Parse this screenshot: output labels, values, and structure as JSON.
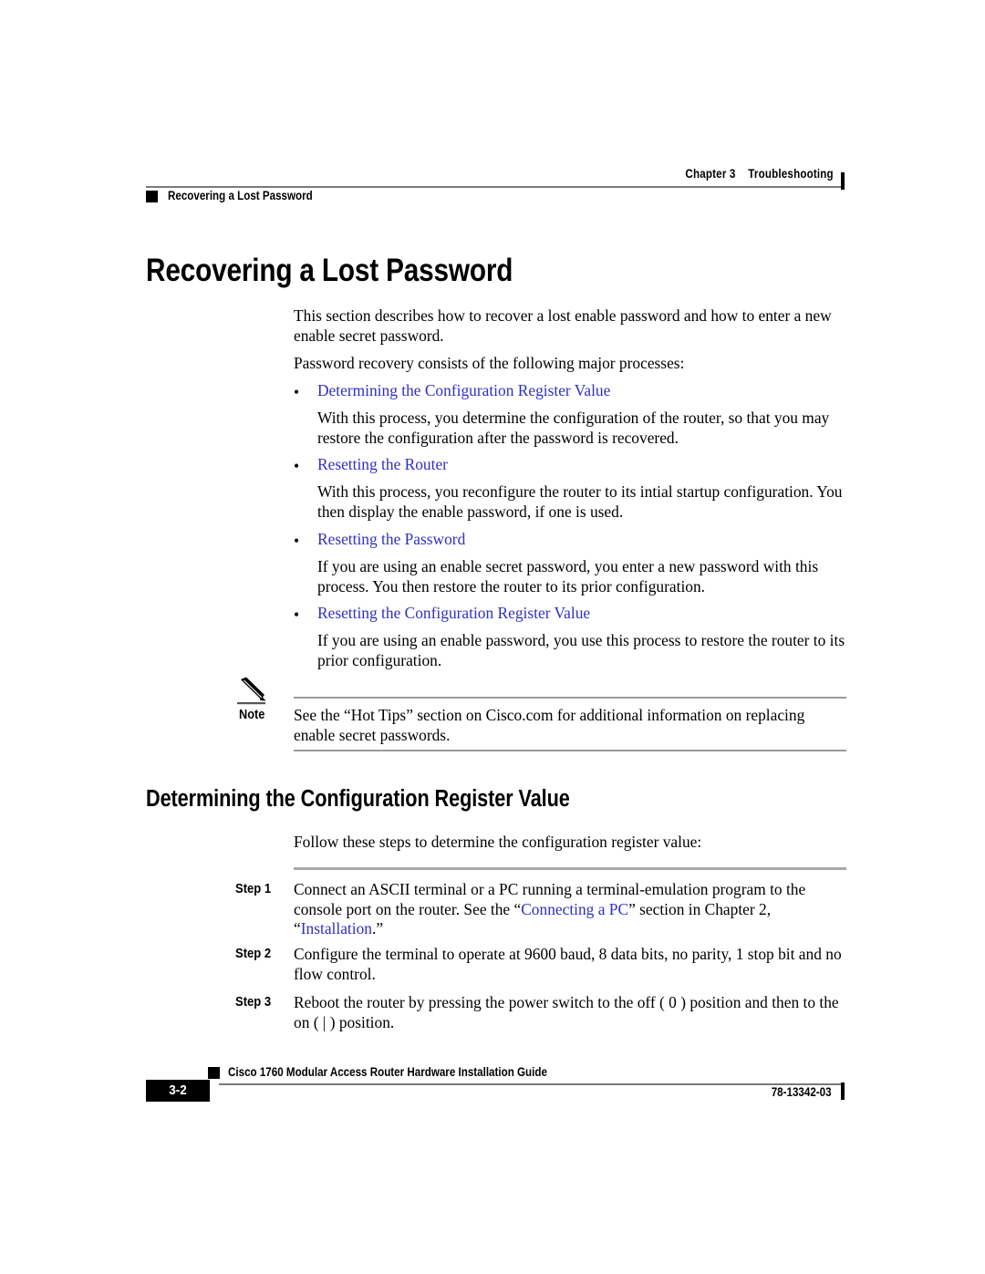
{
  "header": {
    "chapter_label": "Chapter 3",
    "chapter_title": "Troubleshooting",
    "section_title": "Recovering a Lost Password"
  },
  "main": {
    "title": "Recovering a Lost Password",
    "intro_paragraph": "This section describes how to recover a lost enable password and how to enter a new enable secret password.",
    "processes_lead": "Password recovery consists of the following major processes:",
    "bullet_char": "•",
    "processes": [
      {
        "link": "Determining the Configuration Register Value",
        "description": "With this process, you determine the configuration of the router, so that you may restore the configuration after the password is recovered."
      },
      {
        "link": "Resetting the Router",
        "description": "With this process, you reconfigure the router to its intial startup configuration. You then display the enable password, if one is used."
      },
      {
        "link": "Resetting the Password",
        "description": "If you are using an enable secret password, you enter a new password with this process. You then restore the router to its prior configuration."
      },
      {
        "link": "Resetting the Configuration Register Value",
        "description": "If you are using an enable password, you use this process to restore the router to its prior configuration."
      }
    ],
    "note": {
      "label": "Note",
      "icon": "pencil-icon",
      "text": "See the “Hot Tips” section on Cisco.com for additional information on replacing enable secret passwords."
    },
    "subheading": "Determining the Configuration Register Value",
    "steps_lead": "Follow these steps to determine the configuration register value:",
    "steps": [
      {
        "label": "Step 1",
        "text_part1": "Connect an ASCII terminal or a PC running a terminal-emulation program to the console port on the router. See the “",
        "link1": "Connecting a PC",
        "text_part2": "” section in Chapter 2, “",
        "link2": "Installation",
        "text_part3": ".”"
      },
      {
        "label": "Step 2",
        "text_part1": "Configure the terminal to operate at 9600 baud, 8 data bits, no parity,  1 stop bit and no flow control.",
        "link1": "",
        "text_part2": "",
        "link2": "",
        "text_part3": ""
      },
      {
        "label": "Step 3",
        "text_part1": "Reboot the router by pressing the power switch to the off ( 0 ) position and then to the on ( | ) position.",
        "link1": "",
        "text_part2": "",
        "link2": "",
        "text_part3": ""
      }
    ]
  },
  "footer": {
    "guide_title": "Cisco 1760 Modular Access Router Hardware Installation Guide",
    "page_number": "3-2",
    "document_number": "78-13342-03"
  },
  "colors": {
    "link": "#2f2fc8",
    "rule": "#7a7a7a",
    "note_rule": "#9a9a9a",
    "step_rule": "#a8a8a8",
    "ink": "#000000",
    "page": "#ffffff"
  }
}
